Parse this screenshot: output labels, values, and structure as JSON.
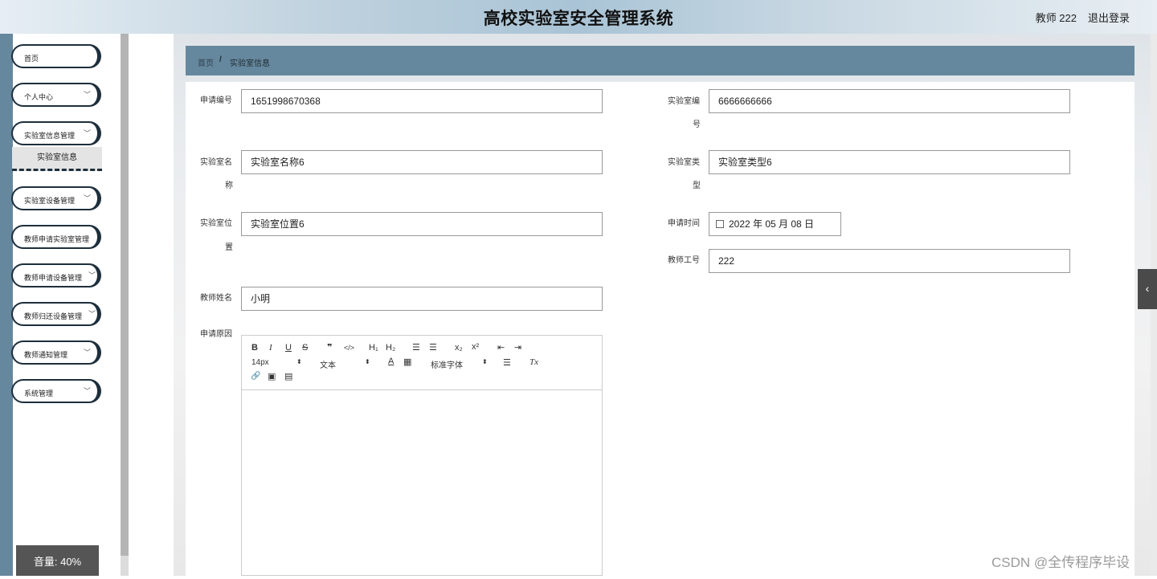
{
  "header": {
    "title": "高校实验室安全管理系统",
    "user": "教师 222",
    "logout": "退出登录"
  },
  "sidebar": {
    "items": [
      {
        "label": "首页",
        "has_chevron": false
      },
      {
        "label": "个人中心",
        "has_chevron": true
      },
      {
        "label": "实验室信息管理",
        "has_chevron": true
      },
      {
        "label": "实验室设备管理",
        "has_chevron": true
      },
      {
        "label": "教师申请实验室管理",
        "has_chevron": false
      },
      {
        "label": "教师申请设备管理",
        "has_chevron": true
      },
      {
        "label": "教师归还设备管理",
        "has_chevron": true
      },
      {
        "label": "教师通知管理",
        "has_chevron": true
      },
      {
        "label": "系统管理",
        "has_chevron": true
      }
    ],
    "active_sub": "实验室信息"
  },
  "breadcrumb": {
    "home": "首页",
    "separator": "/",
    "current": "实验室信息"
  },
  "form": {
    "apply_no_label": "申请编号",
    "apply_no_value": "1651998670368",
    "lab_no_label_1": "实验室编",
    "lab_no_label_2": "号",
    "lab_no_value": "6666666666",
    "lab_name_label_1": "实验室名",
    "lab_name_label_2": "称",
    "lab_name_value": "实验室名称6",
    "lab_type_label_1": "实验室类",
    "lab_type_label_2": "型",
    "lab_type_value": "实验室类型6",
    "lab_loc_label_1": "实验室位",
    "lab_loc_label_2": "置",
    "lab_loc_value": "实验室位置6",
    "apply_time_label": "申请时间",
    "apply_time_value": "2022 年 05 月 08 日",
    "teacher_id_label": "教师工号",
    "teacher_id_value": "222",
    "teacher_name_label": "教师姓名",
    "teacher_name_value": "小明",
    "reason_label": "申请原因"
  },
  "editor": {
    "font_size": "14px",
    "text_type": "文本",
    "font_family": "标准字体",
    "buttons": {
      "bold": "B",
      "italic": "I",
      "underline": "U",
      "strike": "S",
      "quote": "❞",
      "code": "</>",
      "h1": "H₁",
      "h2": "H₂",
      "ol": "☰",
      "ul": "☰",
      "sub": "x₂",
      "sup": "x²",
      "indent_left": "⇤",
      "indent_right": "⇥",
      "color": "A",
      "background": "▦",
      "align": "☰",
      "clear": "Tx",
      "link": "🔗",
      "image": "▣",
      "video": "▤"
    }
  },
  "overlay": {
    "volume": "音量: 40%",
    "watermark": "CSDN @全传程序毕设"
  },
  "colors": {
    "accent": "#66889e",
    "menu_border": "#1e2f3c"
  }
}
